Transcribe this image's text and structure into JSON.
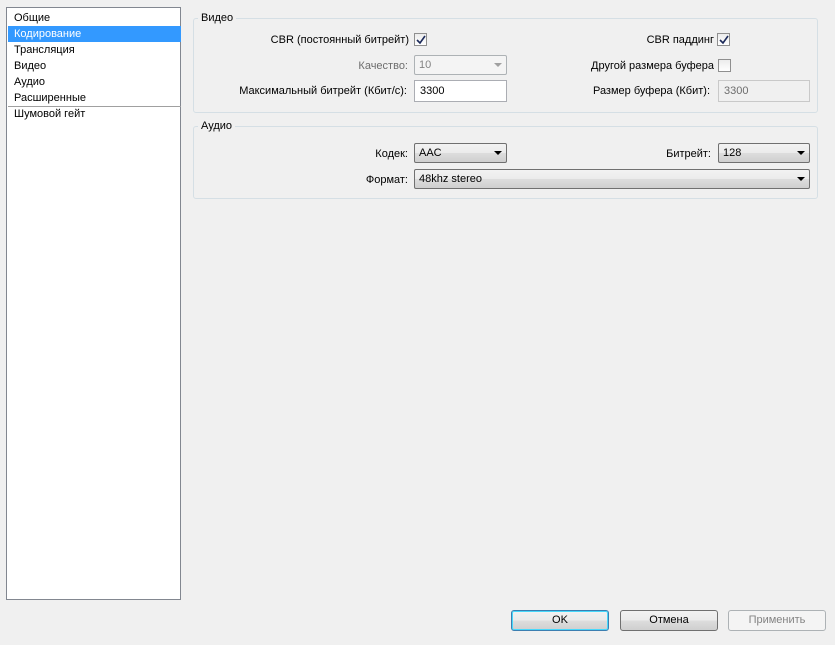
{
  "sidebar": {
    "items": [
      {
        "label": "Общие"
      },
      {
        "label": "Кодирование",
        "selected": true
      },
      {
        "label": "Трансляция"
      },
      {
        "label": "Видео"
      },
      {
        "label": "Аудио"
      },
      {
        "label": "Расширенные"
      },
      {
        "label": "Шумовой гейт"
      }
    ]
  },
  "video": {
    "title": "Видео",
    "cbr_label": "CBR (постоянный битрейт)",
    "cbr_checked": true,
    "cbr_padding_label": "CBR паддинг",
    "cbr_padding_checked": true,
    "quality_label": "Качество:",
    "quality_value": "10",
    "custom_buffer_label": "Другой размера буфера",
    "custom_buffer_checked": false,
    "max_bitrate_label": "Максимальный битрейт (Кбит/с):",
    "max_bitrate_value": "3300",
    "buffer_size_label": "Размер буфера (Кбит):",
    "buffer_size_value": "3300"
  },
  "audio": {
    "title": "Аудио",
    "codec_label": "Кодек:",
    "codec_value": "AAC",
    "bitrate_label": "Битрейт:",
    "bitrate_value": "128",
    "format_label": "Формат:",
    "format_value": "48khz stereo"
  },
  "buttons": {
    "ok": "OK",
    "cancel": "Отмена",
    "apply": "Применить"
  },
  "colors": {
    "selection": "#3399ff",
    "window_bg": "#f0f0f0"
  }
}
